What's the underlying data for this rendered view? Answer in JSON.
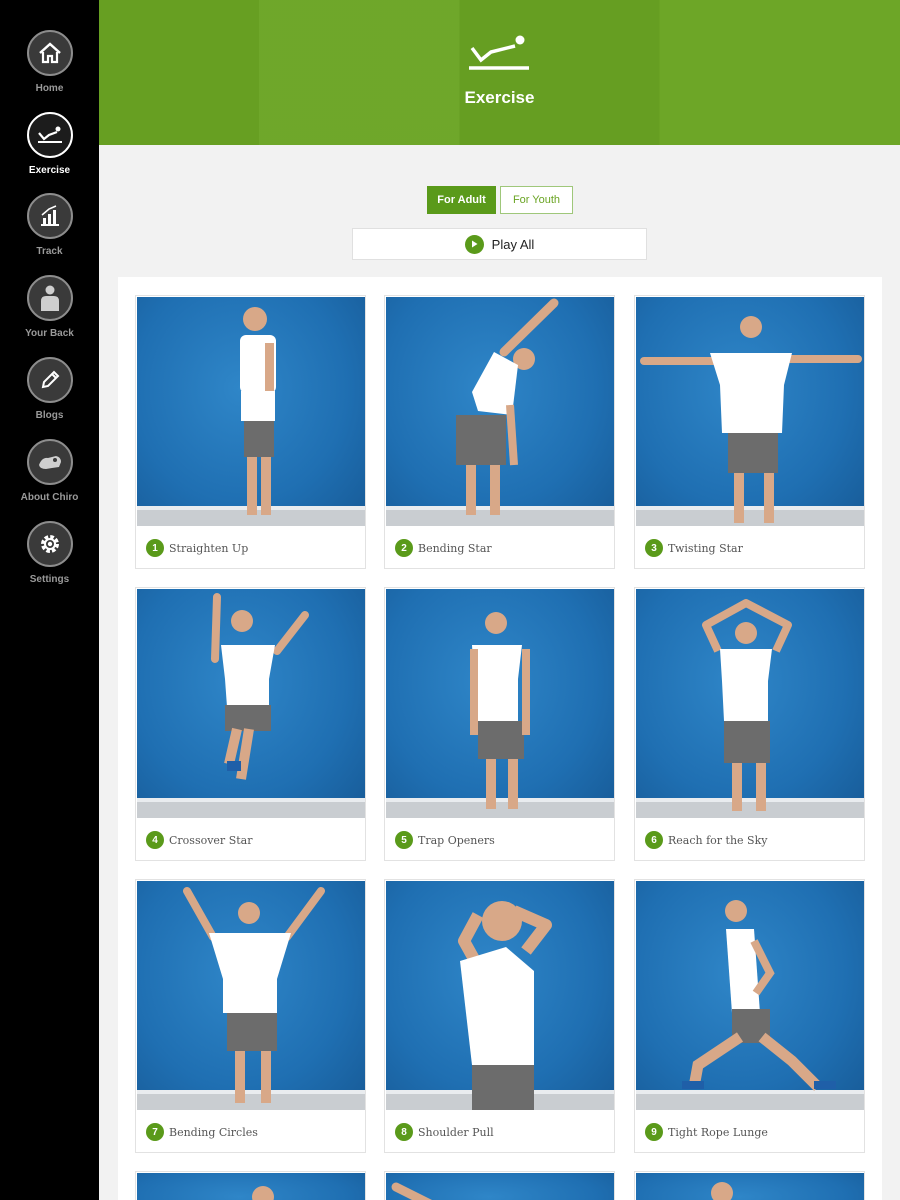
{
  "sidebar": {
    "items": [
      {
        "label": "Home",
        "icon": "home-icon",
        "active": false
      },
      {
        "label": "Exercise",
        "icon": "exercise-icon",
        "active": true
      },
      {
        "label": "Track",
        "icon": "track-chart-icon",
        "active": false
      },
      {
        "label": "Your Back",
        "icon": "person-body-icon",
        "active": false
      },
      {
        "label": "Blogs",
        "icon": "pencil-icon",
        "active": false
      },
      {
        "label": "About Chiro",
        "icon": "chiro-icon",
        "active": false
      },
      {
        "label": "Settings",
        "icon": "gear-icon",
        "active": false
      }
    ]
  },
  "header": {
    "title": "Exercise",
    "icon": "exercise-icon",
    "color": "#6aa423"
  },
  "toggle": {
    "adult_label": "For Adult",
    "youth_label": "For Youth",
    "selected": "For Adult"
  },
  "play_all": {
    "label": "Play All",
    "icon": "play-icon"
  },
  "exercises": [
    {
      "number": "1",
      "name": "Straighten Up"
    },
    {
      "number": "2",
      "name": "Bending Star"
    },
    {
      "number": "3",
      "name": "Twisting Star"
    },
    {
      "number": "4",
      "name": "Crossover Star"
    },
    {
      "number": "5",
      "name": "Trap Openers"
    },
    {
      "number": "6",
      "name": "Reach for the Sky"
    },
    {
      "number": "7",
      "name": "Bending Circles"
    },
    {
      "number": "8",
      "name": "Shoulder Pull"
    },
    {
      "number": "9",
      "name": "Tight Rope Lunge"
    }
  ],
  "colors": {
    "accent": "#5a9a1a",
    "photo_background": "#1f6fb2",
    "sidebar": "#000000"
  }
}
